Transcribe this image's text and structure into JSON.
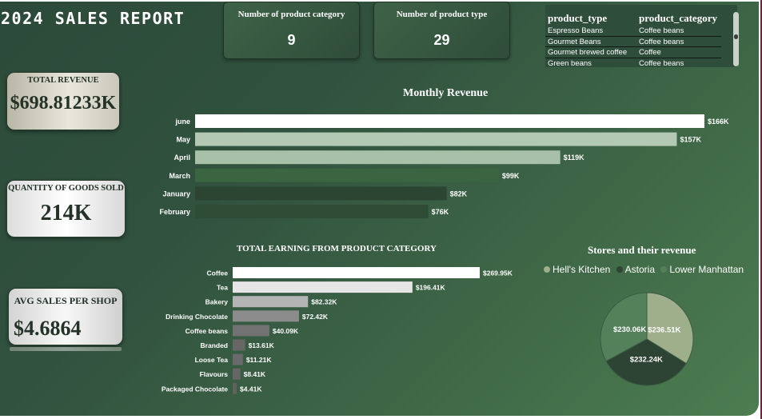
{
  "report_title": "2024 SALES REPORT",
  "kpis_top": [
    {
      "label": "Number of product category",
      "value": "9"
    },
    {
      "label": "Number of product type",
      "value": "29"
    }
  ],
  "product_table": {
    "headers": [
      "product_type",
      "product_category"
    ],
    "rows": [
      [
        "Espresso Beans",
        "Coffee beans"
      ],
      [
        "Gourmet Beans",
        "Coffee beans"
      ],
      [
        "Gourmet brewed coffee",
        "Coffee"
      ],
      [
        "Green beans",
        "Coffee beans"
      ]
    ]
  },
  "cards": {
    "total_revenue": {
      "label": "TOTAL REVENUE",
      "value": "$698.81233K"
    },
    "quantity": {
      "label": "QUANTITY OF GOODS SOLD",
      "value": "214K"
    },
    "avg_sales": {
      "label": "AVG SALES PER SHOP",
      "value": "$4.6864"
    }
  },
  "chart_data": [
    {
      "type": "bar",
      "orientation": "horizontal",
      "title": "Monthly Revenue",
      "categories": [
        "june",
        "May",
        "April",
        "March",
        "January",
        "February"
      ],
      "values": [
        166,
        157,
        119,
        99,
        82,
        76
      ],
      "value_labels": [
        "$166K",
        "$157K",
        "$119K",
        "$99K",
        "$82K",
        "$76K"
      ],
      "colors": [
        "#ffffff",
        "#b3c9b3",
        "#a8c0a8",
        "#3b6441",
        "#2c4532",
        "#2f4d36"
      ],
      "xlim": [
        0,
        166
      ],
      "grid": false
    },
    {
      "type": "bar",
      "orientation": "horizontal",
      "title": "TOTAL EARNING FROM PRODUCT CATEGORY",
      "categories": [
        "Coffee",
        "Tea",
        "Bakery",
        "Drinking Chocolate",
        "Coffee beans",
        "Branded",
        "Loose Tea",
        "Flavours",
        "Packaged Chocolate"
      ],
      "values": [
        269.95,
        196.41,
        82.32,
        72.42,
        40.09,
        13.61,
        11.21,
        8.41,
        4.41
      ],
      "value_labels": [
        "$269.95K",
        "$196.41K",
        "$82.32K",
        "$72.42K",
        "$40.09K",
        "$13.61K",
        "$11.21K",
        "$8.41K",
        "$4.41K"
      ],
      "colors": [
        "#ffffff",
        "#e6e6e6",
        "#b4b4b4",
        "#8c8c8c",
        "#727272",
        "#676767",
        "#6a6a6a",
        "#666666",
        "#616161"
      ],
      "xlim": [
        0,
        269.95
      ],
      "grid": false
    },
    {
      "type": "pie",
      "title": "Stores and their revenue",
      "labels": [
        "Hell's Kitchen",
        "Astoria",
        "Lower Manhattan"
      ],
      "values": [
        236.51,
        232.24,
        230.06
      ],
      "value_labels": [
        "$236.51K",
        "$232.24K",
        "$230.06K"
      ],
      "colors": [
        "#9fae8b",
        "#2d4434",
        "#54805a"
      ],
      "legend_position": "top"
    }
  ]
}
